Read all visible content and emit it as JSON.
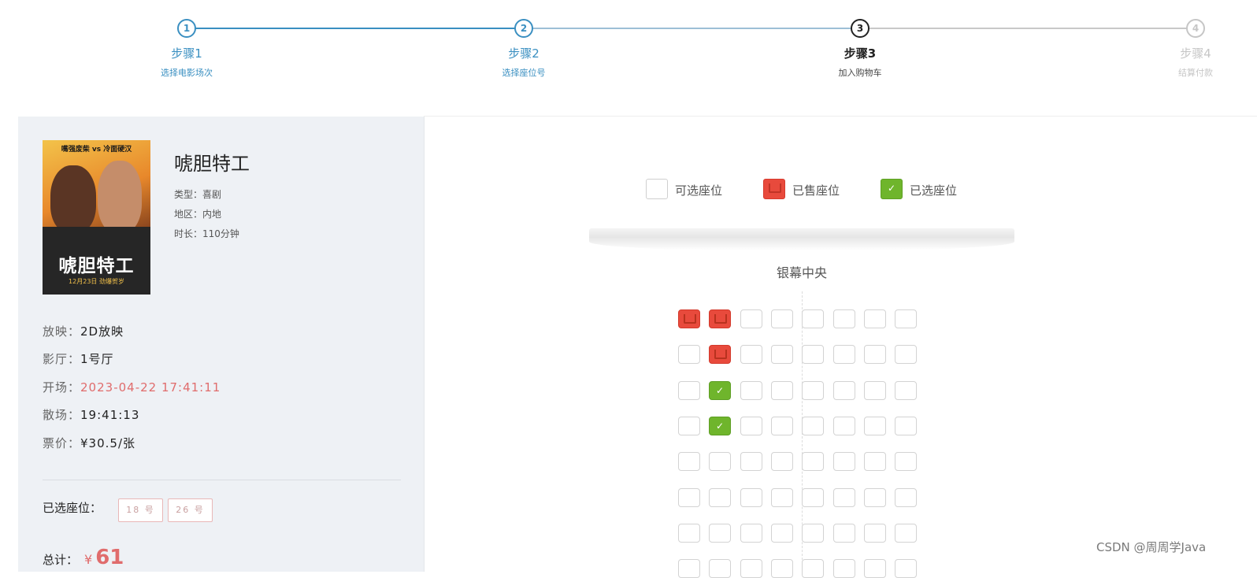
{
  "steps": [
    {
      "number": "1",
      "title": "步骤1",
      "desc": "选择电影场次",
      "state": "done"
    },
    {
      "number": "2",
      "title": "步骤2",
      "desc": "选择座位号",
      "state": "done"
    },
    {
      "number": "3",
      "title": "步骤3",
      "desc": "加入购物车",
      "state": "active"
    },
    {
      "number": "4",
      "title": "步骤4",
      "desc": "结算付款",
      "state": "todo"
    }
  ],
  "movie": {
    "title": "唬胆特工",
    "type_label": "类型：",
    "type": "喜剧",
    "region_label": "地区：",
    "region": "内地",
    "duration_label": "时长：",
    "duration": "110分钟",
    "poster": {
      "tagline": "嘴强废柴 vs 冷面硬汉",
      "title": "唬胆特工",
      "date": "12月23日 劲爆贺岁"
    }
  },
  "session": {
    "format_label": "放映：",
    "format": "2D放映",
    "hall_label": "影厅：",
    "hall": "1号厅",
    "start_label": "开场：",
    "start": "2023-04-22 17:41:11",
    "end_label": "散场：",
    "end": "19:41:13",
    "price_label": "票价：",
    "price": "¥30.5/张"
  },
  "selected": {
    "label": "已选座位：",
    "seats": [
      "18 号",
      "26 号"
    ]
  },
  "total": {
    "label": "总计：",
    "currency": "¥",
    "amount": "61"
  },
  "legend": {
    "available": "可选座位",
    "sold": "已售座位",
    "selected": "已选座位"
  },
  "screen_label": "银幕中央",
  "check_glyph": "✓",
  "colors": {
    "accent": "#3a8fc1",
    "sold": "#e84a3c",
    "selected": "#6fb52c",
    "price": "#e06c6c"
  },
  "seat_grid": [
    [
      "sold",
      "sold",
      "avail",
      "avail",
      "avail",
      "avail",
      "avail",
      "avail"
    ],
    [
      "avail",
      "sold",
      "avail",
      "avail",
      "avail",
      "avail",
      "avail",
      "avail"
    ],
    [
      "avail",
      "selected",
      "avail",
      "avail",
      "avail",
      "avail",
      "avail",
      "avail"
    ],
    [
      "avail",
      "selected",
      "avail",
      "avail",
      "avail",
      "avail",
      "avail",
      "avail"
    ],
    [
      "avail",
      "avail",
      "avail",
      "avail",
      "avail",
      "avail",
      "avail",
      "avail"
    ],
    [
      "avail",
      "avail",
      "avail",
      "avail",
      "avail",
      "avail",
      "avail",
      "avail"
    ],
    [
      "avail",
      "avail",
      "avail",
      "avail",
      "avail",
      "avail",
      "avail",
      "avail"
    ],
    [
      "avail",
      "avail",
      "avail",
      "avail",
      "avail",
      "avail",
      "avail",
      "avail"
    ]
  ],
  "watermark": "CSDN @周周学Java"
}
